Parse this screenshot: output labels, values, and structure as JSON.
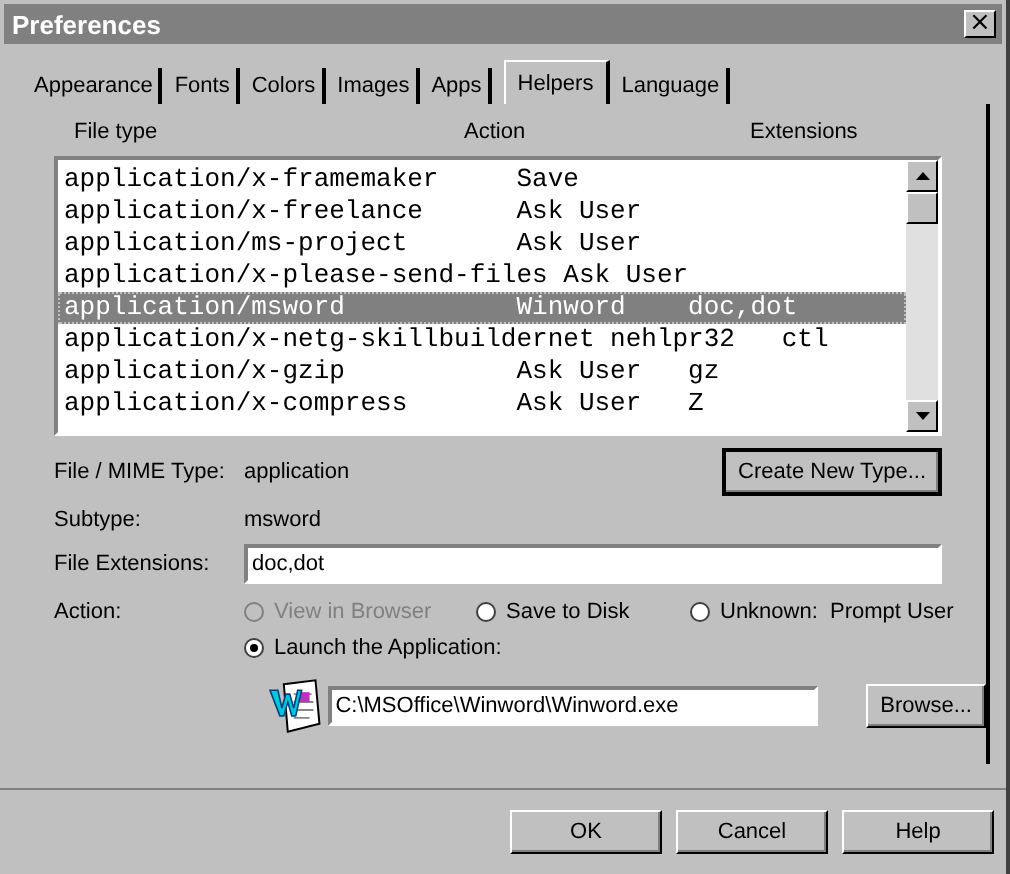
{
  "window": {
    "title": "Preferences",
    "close": "×"
  },
  "tabs": [
    {
      "label": "Appearance",
      "selected": false
    },
    {
      "label": "Fonts",
      "selected": false
    },
    {
      "label": "Colors",
      "selected": false
    },
    {
      "label": "Images",
      "selected": false
    },
    {
      "label": "Apps",
      "selected": false
    },
    {
      "label": "Helpers",
      "selected": true
    },
    {
      "label": "Language",
      "selected": false
    }
  ],
  "list": {
    "columns": [
      "File type",
      "Action",
      "Extensions"
    ],
    "rows": [
      {
        "line": "application/x-framemaker     Save",
        "selected": false
      },
      {
        "line": "application/x-freelance      Ask User",
        "selected": false
      },
      {
        "line": "application/ms-project       Ask User",
        "selected": false
      },
      {
        "line": "application/x-please-send-files Ask User",
        "selected": false
      },
      {
        "line": "application/msword           Winword    doc,dot",
        "selected": true
      },
      {
        "line": "application/x-netg-skillbuildernet nehlpr32   ctl",
        "selected": false
      },
      {
        "line": "application/x-gzip           Ask User   gz",
        "selected": false
      },
      {
        "line": "application/x-compress       Ask User   Z",
        "selected": false
      }
    ]
  },
  "details": {
    "mime_label": "File / MIME Type:",
    "mime_value": "application",
    "subtype_label": "Subtype:",
    "subtype_value": "msword",
    "create_button": "Create New Type...",
    "extensions_label": "File Extensions:",
    "extensions_value": "doc,dot"
  },
  "action": {
    "label": "Action:",
    "options": [
      {
        "label": "View in Browser",
        "selected": false,
        "disabled": true
      },
      {
        "label": "Save to Disk",
        "selected": false,
        "disabled": false
      },
      {
        "label": "Unknown:  Prompt User",
        "selected": false,
        "disabled": false
      },
      {
        "label": "Launch the Application:",
        "selected": true,
        "disabled": false
      }
    ],
    "app_path": "C:\\MSOffice\\Winword\\Winword.exe",
    "browse_button": "Browse..."
  },
  "buttons": [
    "OK",
    "Cancel",
    "Help"
  ]
}
